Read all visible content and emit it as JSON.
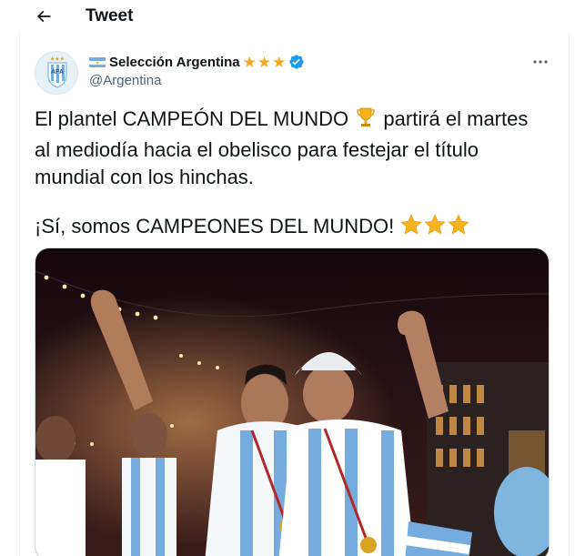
{
  "header": {
    "title": "Tweet"
  },
  "tweet": {
    "author": {
      "display_name": "Selección Argentina",
      "handle": "@Argentina",
      "badge_stars": 3,
      "verified": true
    },
    "text_line1_a": "El plantel CAMPEÓN DEL MUNDO",
    "text_line1_b": " partirá el martes",
    "text_line2": "al mediodía hacia el obelisco para festejar el título",
    "text_line3": "mundial con los hinchas.",
    "text_line4": "¡Sí, somos CAMPEONES DEL MUNDO!",
    "photo": {
      "alt": ""
    }
  },
  "colors": {
    "text": "#0f1419",
    "secondary": "#536471",
    "verified_blue": "#1d9bf0",
    "star_gold": "#f5a623",
    "argentina_sky": "#74acdf"
  },
  "icons": [
    "back-arrow-icon",
    "argentina-flag-icon",
    "star-icon",
    "verified-badge-icon",
    "more-options-icon",
    "trophy-icon"
  ]
}
